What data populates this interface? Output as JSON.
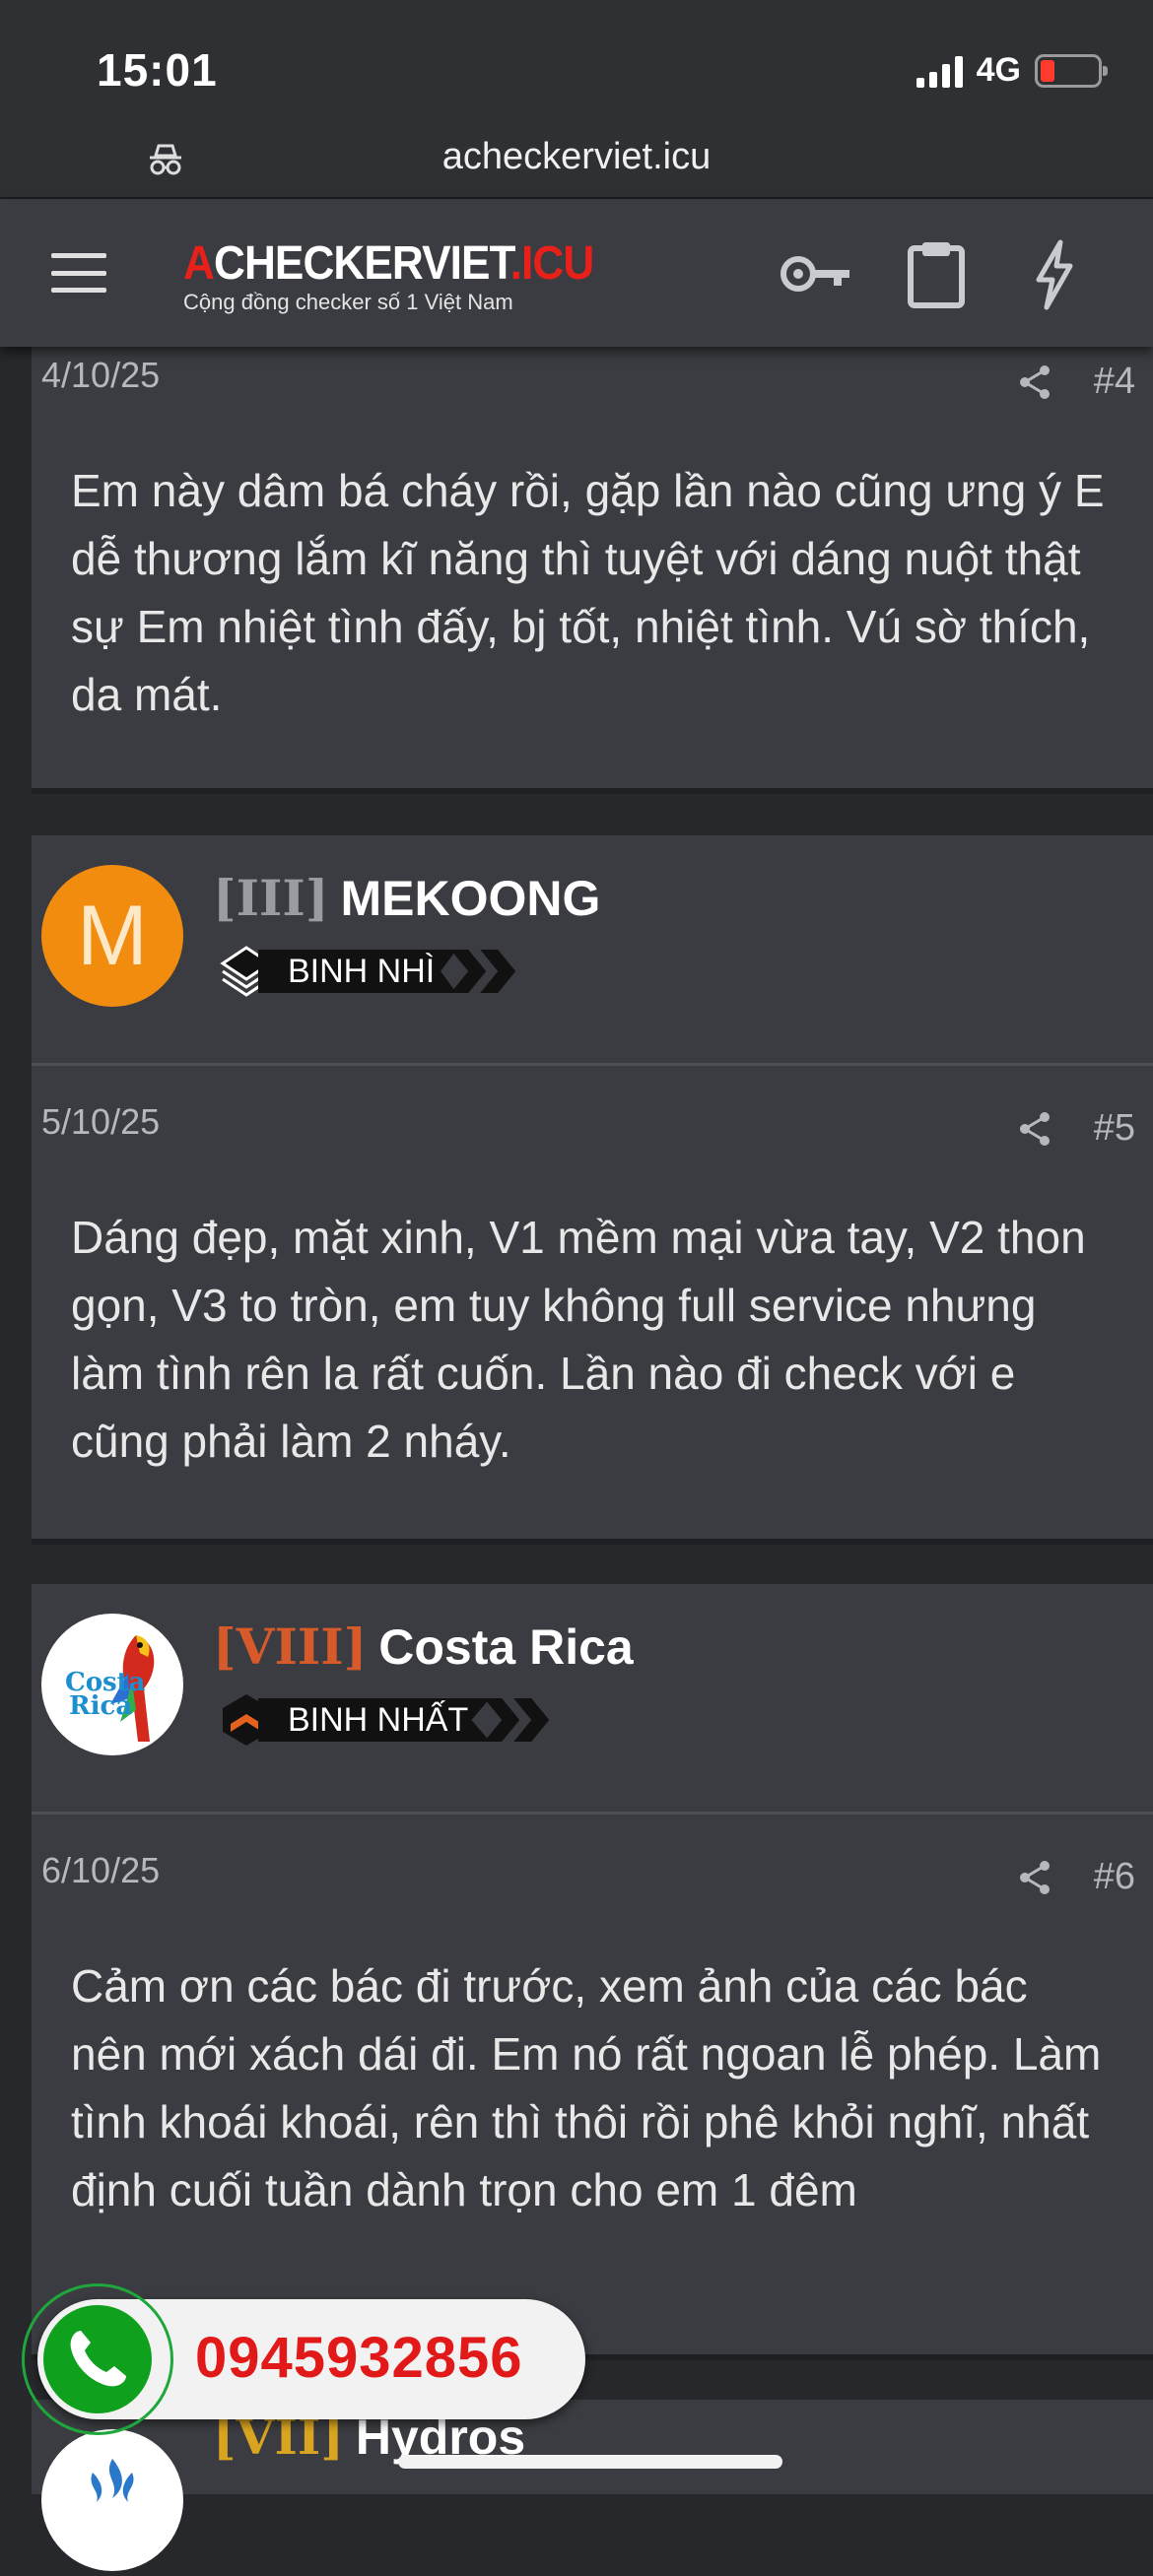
{
  "status_bar": {
    "time": "15:01",
    "network": "4G",
    "battery_color": "#ff3b30"
  },
  "browser": {
    "url": "acheckerviet.icu"
  },
  "header": {
    "logo_a": "A",
    "logo_mid": "CHECKERVIET",
    "logo_tld": ".ICU",
    "tagline": "Cộng đồng checker số 1 Việt Nam"
  },
  "posts": [
    {
      "date": "4/10/25",
      "number": "#4",
      "text": "Em này dâm bá cháy rồi, gặp lần nào cũng ưng ý E dễ thương lắm kĩ năng thì tuyệt với dáng nuột thật sự Em nhiệt tình đấy, bj tốt, nhiệt tình. Vú sờ thích, da mát."
    },
    {
      "user": {
        "rank": "[III]",
        "name": "MEKOONG",
        "avatar_letter": "M",
        "badge": "BINH NHÌ",
        "rank_color": "#9a9ca0"
      },
      "date": "5/10/25",
      "number": "#5",
      "text": "Dáng đẹp, mặt xinh, V1 mềm mại vừa tay, V2 thon gọn, V3 to tròn, em tuy không full service nhưng làm tình rên la rất cuốn. Lần nào đi check với e cũng phải làm 2 nháy."
    },
    {
      "user": {
        "rank": "[VIII]",
        "name": "Costa Rica",
        "badge": "BINH NHẤT",
        "rank_color": "#d65a2a",
        "avatar_text": [
          "Costa",
          "Rica"
        ]
      },
      "date": "6/10/25",
      "number": "#6",
      "text": "Cảm ơn các bác đi trước, xem ảnh của các bác nên mới xách dái đi. Em nó rất ngoan lễ phép. Làm tình khoái khoái, rên thì thôi rồi phê khỏi nghĩ, nhất định cuối tuần dành trọn cho em 1 đêm"
    },
    {
      "user": {
        "rank": "[VII]",
        "name": "Hydros",
        "rank_color": "#d9a520"
      }
    }
  ],
  "floating_call": {
    "phone": "0945932856"
  }
}
